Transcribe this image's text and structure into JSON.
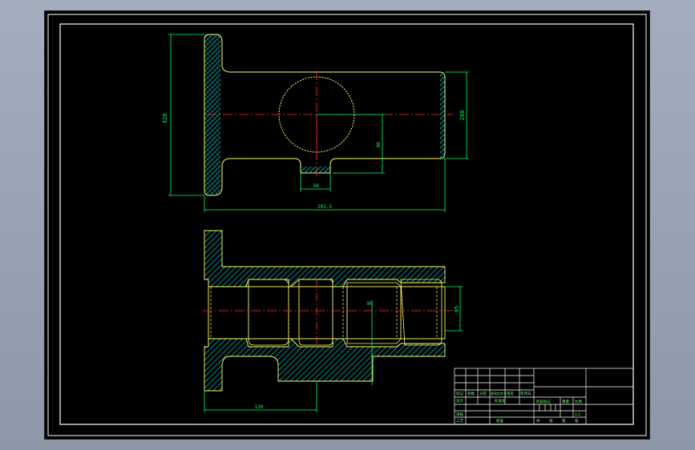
{
  "drawing": {
    "colors": {
      "background": "#000000",
      "outline": "#ffff66",
      "dimension": "#00ff66",
      "centerline": "#ff3030",
      "hatch": "#00c8c8",
      "border": "#ffffff"
    },
    "top_view_dimensions": {
      "flange_height": "320",
      "body_height": "200",
      "vertical_offset": "90",
      "slot_width": "50",
      "overall_length": "202.5"
    },
    "section_view_dimensions": {
      "bore": "95",
      "inner_offset": "90",
      "flange_to_slot": "120"
    },
    "title_block": {
      "header_cells": [
        "标记",
        "处数",
        "分区",
        "更改文件号",
        "签名",
        "年月日"
      ],
      "design_cells": [
        "设计",
        "标准化"
      ],
      "review_cells": [
        "审核",
        "工艺",
        "批准"
      ],
      "stage_label": "阶段标记",
      "weight_label": "重量",
      "scale_label": "比例",
      "scale_value": "1:1",
      "sheet_cells": [
        "共",
        "张",
        "第",
        "张"
      ]
    }
  }
}
